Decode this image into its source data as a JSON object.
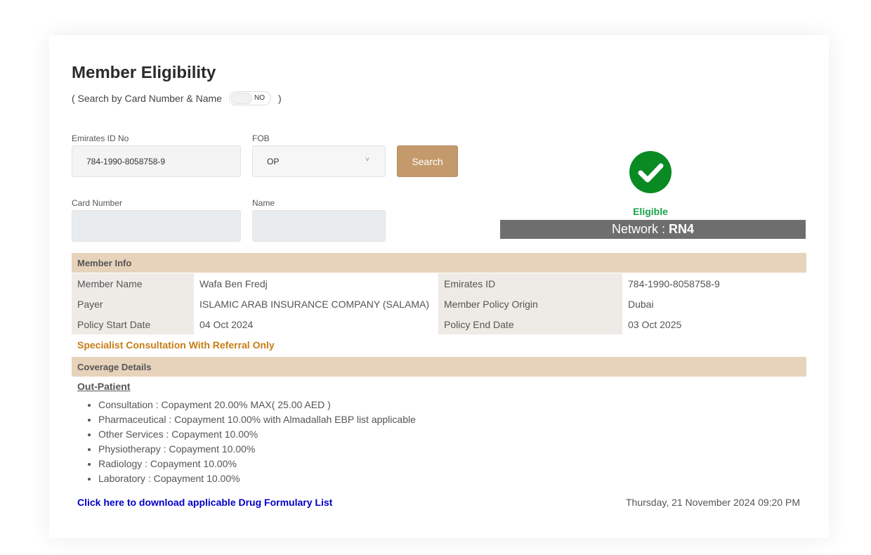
{
  "page": {
    "title": "Member Eligibility",
    "subtitle_prefix": "( Search by Card Number & Name",
    "subtitle_suffix": ")",
    "toggle_state": "NO"
  },
  "form": {
    "emirates_id_label": "Emirates ID No",
    "emirates_id_value": "784-1990-8058758-9",
    "fob_label": "FOB",
    "fob_value": "OP",
    "search_label": "Search",
    "card_number_label": "Card Number",
    "card_number_value": "",
    "name_label": "Name",
    "name_value": ""
  },
  "status": {
    "eligibility": "Eligible",
    "network_label": "Network :",
    "network_value": "RN4",
    "accent_color": "#0a8a23"
  },
  "member_info": {
    "header": "Member Info",
    "rows": [
      {
        "k1": "Member Name",
        "v1": "Wafa Ben Fredj",
        "k2": "Emirates ID",
        "v2": "784-1990-8058758-9"
      },
      {
        "k1": "Payer",
        "v1": "ISLAMIC ARAB INSURANCE COMPANY (SALAMA)",
        "k2": "Member Policy Origin",
        "v2": "Dubai"
      },
      {
        "k1": "Policy Start Date",
        "v1": "04 Oct 2024",
        "k2": "Policy End Date",
        "v2": "03 Oct 2025"
      }
    ],
    "note": "Specialist Consultation With Referral Only"
  },
  "coverage": {
    "header": "Coverage Details",
    "section_title": "Out-Patient",
    "items": [
      "Consultation : Copayment 20.00% MAX( 25.00 AED )",
      "Pharmaceutical : Copayment 10.00% with Almadallah EBP list applicable",
      "Other Services : Copayment 10.00%",
      "Physiotherapy : Copayment 10.00%",
      "Radiology : Copayment 10.00%",
      "Laboratory : Copayment 10.00%"
    ]
  },
  "footer": {
    "download_link": "Click here to download applicable Drug Formulary List",
    "timestamp": "Thursday, 21 November 2024 09:20 PM"
  }
}
